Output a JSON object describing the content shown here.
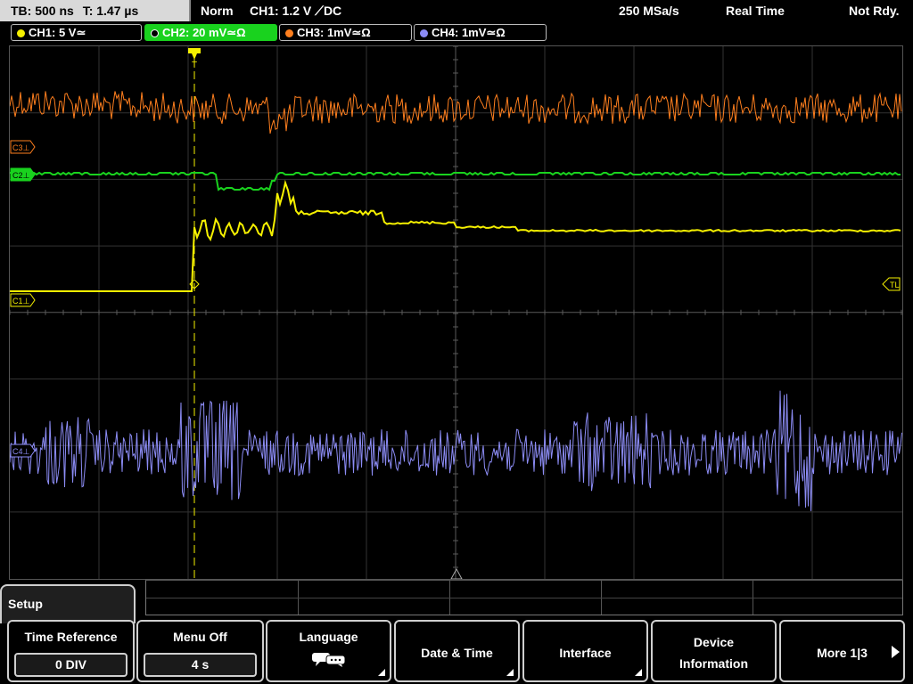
{
  "status_bar": {
    "timebase": "TB: 500 ns",
    "trigger_time": "T: 1.47 µs",
    "acq_mode": "Norm",
    "trigger_info": "CH1: 1.2 V ⟋DC",
    "sample_rate": "250 MSa/s",
    "time_mode": "Real Time",
    "trigger_status": "Not Rdy."
  },
  "channels": [
    {
      "label": "CH1: 5 V≃",
      "color": "#f5f000",
      "active": false
    },
    {
      "label": "CH2: 20 mV≃Ω",
      "color": "#19d21e",
      "active": true
    },
    {
      "label": "CH3: 1mV≃Ω",
      "color": "#ff7f1e",
      "active": false
    },
    {
      "label": "CH4: 1mV≃Ω",
      "color": "#8c8cf5",
      "active": false
    }
  ],
  "markers": {
    "c3": "C3⊥",
    "c2": "C2⊥",
    "c1": "C1⊥",
    "c4": "C4⊥",
    "trigger_level": "TL",
    "trigger_pos": "T"
  },
  "colors": {
    "ch1": "#f5f000",
    "ch2": "#19d21e",
    "ch3": "#ff7f1e",
    "ch4": "#8c8cf5",
    "grid": "#3a3a3a"
  },
  "menu": {
    "title": "Setup",
    "softkeys": [
      {
        "label": "Time Reference",
        "value": "0 DIV"
      },
      {
        "label": "Menu Off",
        "value": "4 s"
      },
      {
        "label": "Language",
        "icon": "speech-bubbles-icon"
      },
      {
        "label": "Date & Time"
      },
      {
        "label": "Interface"
      },
      {
        "label_line1": "Device",
        "label_line2": "Information"
      },
      {
        "label": "More 1|3"
      }
    ]
  }
}
